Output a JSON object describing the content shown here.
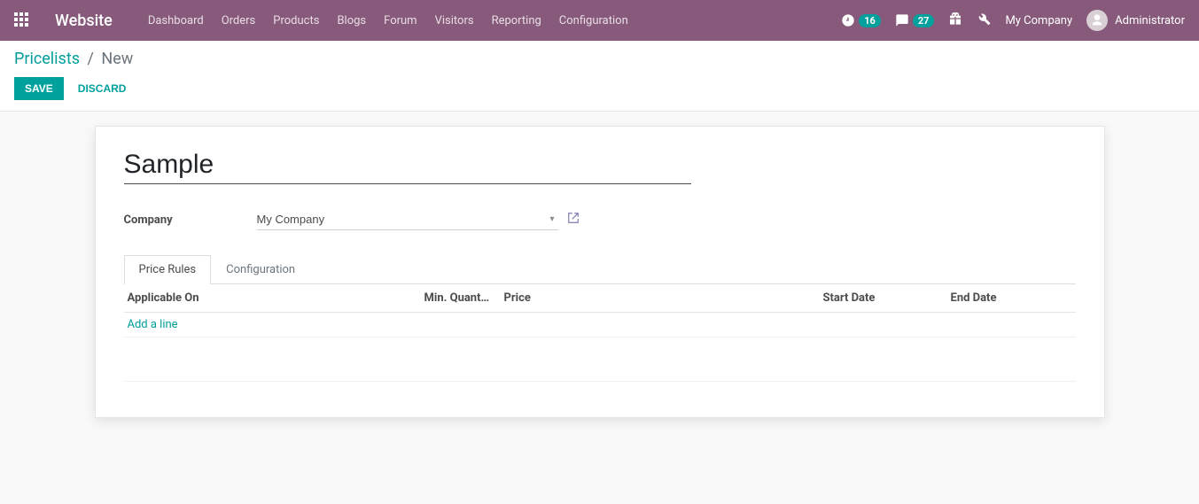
{
  "nav": {
    "brand": "Website",
    "items": [
      "Dashboard",
      "Orders",
      "Products",
      "Blogs",
      "Forum",
      "Visitors",
      "Reporting",
      "Configuration"
    ],
    "clock_badge": "16",
    "chat_badge": "27",
    "company": "My Company",
    "user": "Administrator"
  },
  "breadcrumb": {
    "root": "Pricelists",
    "current": "New"
  },
  "buttons": {
    "save": "SAVE",
    "discard": "DISCARD"
  },
  "form": {
    "name_value": "Sample",
    "company_label": "Company",
    "company_value": "My Company"
  },
  "tabs": {
    "price_rules": "Price Rules",
    "configuration": "Configuration"
  },
  "table": {
    "headers": {
      "applicable_on": "Applicable On",
      "min_qty": "Min. Quant…",
      "price": "Price",
      "start_date": "Start Date",
      "end_date": "End Date"
    },
    "add_line": "Add a line"
  }
}
